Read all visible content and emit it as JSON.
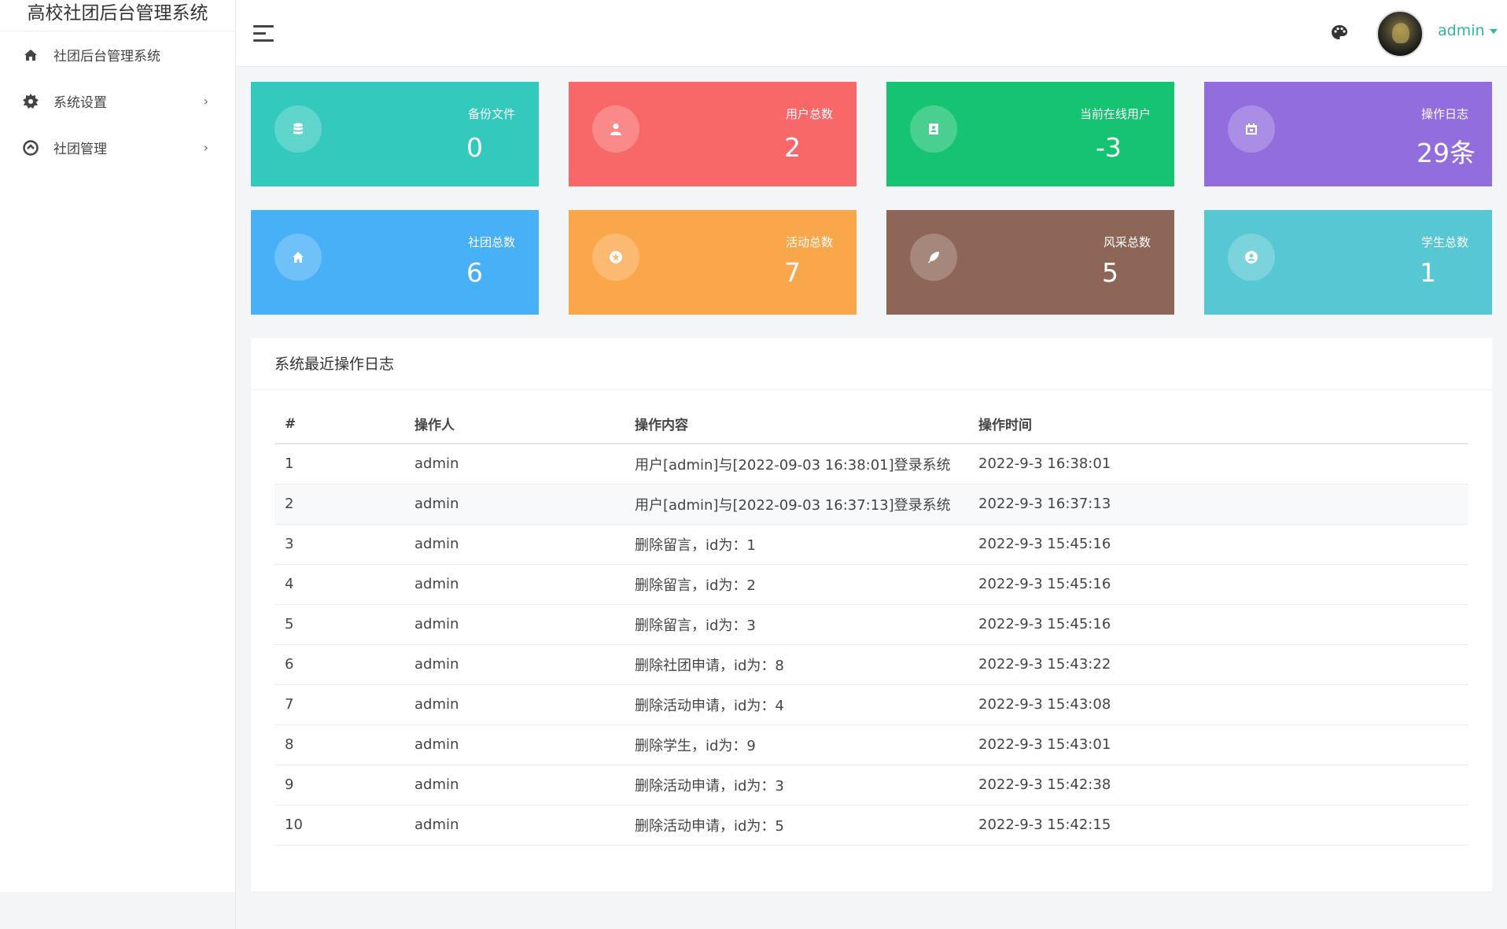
{
  "sidebar": {
    "brand": "高校社团后台管理系统",
    "items": [
      {
        "label": "社团后台管理系统",
        "icon": "home-icon",
        "has_children": false
      },
      {
        "label": "系统设置",
        "icon": "gear-icon",
        "has_children": true
      },
      {
        "label": "社团管理",
        "icon": "circle-up-icon",
        "has_children": true
      }
    ],
    "chevron": "›"
  },
  "header": {
    "user_name": "admin"
  },
  "cards": [
    {
      "label": "备份文件",
      "value": "0",
      "color": "#34c9bd",
      "icon": "database-icon"
    },
    {
      "label": "用户总数",
      "value": "2",
      "color": "#f96868",
      "icon": "user-icon"
    },
    {
      "label": "当前在线用户",
      "value": "-3",
      "color": "#16c372",
      "icon": "contact-card-icon"
    },
    {
      "label": "操作日志",
      "value": "29条",
      "color": "#926dde",
      "icon": "calendar-icon"
    },
    {
      "label": "社团总数",
      "value": "6",
      "color": "#48b0f7",
      "icon": "home-icon"
    },
    {
      "label": "活动总数",
      "value": "7",
      "color": "#faa64b",
      "icon": "star-circle-icon"
    },
    {
      "label": "风采总数",
      "value": "5",
      "color": "#8d6658",
      "icon": "feather-icon"
    },
    {
      "label": "学生总数",
      "value": "1",
      "color": "#57c7d4",
      "icon": "user-circle-icon"
    }
  ],
  "log_panel": {
    "title": "系统最近操作日志",
    "columns": [
      "#",
      "操作人",
      "操作内容",
      "操作时间"
    ],
    "rows": [
      [
        "1",
        "admin",
        "用户[admin]与[2022-09-03 16:38:01]登录系统",
        "2022-9-3 16:38:01"
      ],
      [
        "2",
        "admin",
        "用户[admin]与[2022-09-03 16:37:13]登录系统",
        "2022-9-3 16:37:13"
      ],
      [
        "3",
        "admin",
        "删除留言，id为：1",
        "2022-9-3 15:45:16"
      ],
      [
        "4",
        "admin",
        "删除留言，id为：2",
        "2022-9-3 15:45:16"
      ],
      [
        "5",
        "admin",
        "删除留言，id为：3",
        "2022-9-3 15:45:16"
      ],
      [
        "6",
        "admin",
        "删除社团申请，id为：8",
        "2022-9-3 15:43:22"
      ],
      [
        "7",
        "admin",
        "删除活动申请，id为：4",
        "2022-9-3 15:43:08"
      ],
      [
        "8",
        "admin",
        "删除学生，id为：9",
        "2022-9-3 15:43:01"
      ],
      [
        "9",
        "admin",
        "删除活动申请，id为：3",
        "2022-9-3 15:42:38"
      ],
      [
        "10",
        "admin",
        "删除活动申请，id为：5",
        "2022-9-3 15:42:15"
      ]
    ]
  }
}
